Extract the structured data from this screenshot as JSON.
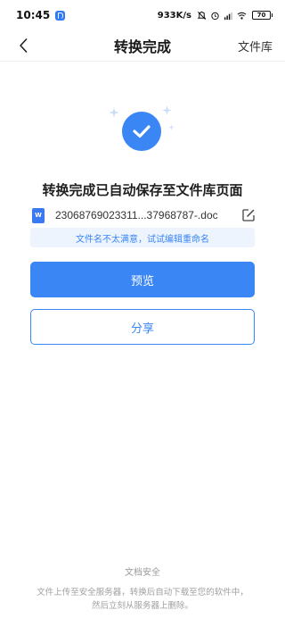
{
  "status_bar": {
    "time": "10:45",
    "net_speed": "933K/s",
    "battery": "70"
  },
  "nav": {
    "title": "转换完成",
    "right_link": "文件库"
  },
  "result": {
    "headline": "转换完成已自动保存至文件库页面",
    "file_type_label": "W",
    "file_name": "23068769023311...37968787-.doc",
    "rename_tip": "文件名不太满意，试试编辑重命名"
  },
  "actions": {
    "preview_label": "预览",
    "share_label": "分享"
  },
  "footer": {
    "title": "文档安全",
    "text": "文件上传至安全服务器，转换后自动下载至您的软件中，然后立刻从服务器上删除。"
  },
  "colors": {
    "accent": "#3a86f4",
    "tip_bg": "#eef4fd"
  }
}
